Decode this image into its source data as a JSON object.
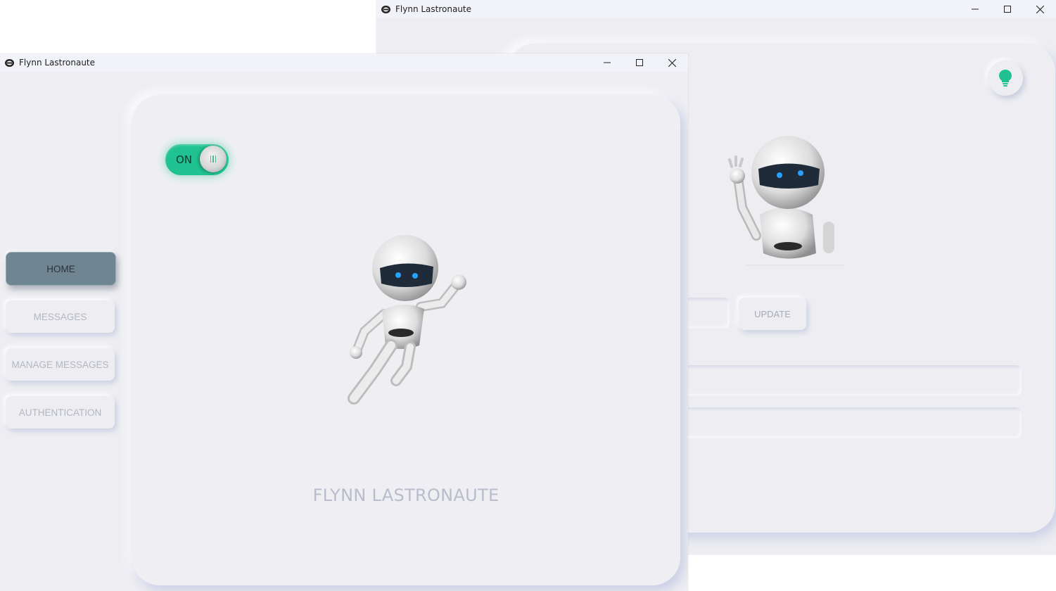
{
  "windows": {
    "back": {
      "title": "Flynn Lastronaute",
      "update_label": "UPDATE",
      "bulb_icon": "lightbulb-icon",
      "accent": "#1fc290"
    },
    "front": {
      "title": "Flynn Lastronaute",
      "nav": {
        "items": [
          {
            "label": "HOME",
            "active": true
          },
          {
            "label": "MESSAGES",
            "active": false
          },
          {
            "label": "MANAGE MESSAGES",
            "active": false
          },
          {
            "label": "AUTHENTICATION",
            "active": false
          }
        ]
      },
      "toggle": {
        "label": "ON",
        "state": true,
        "color": "#1fc290"
      },
      "brand_name": "FLYNN LASTRONAUTE"
    }
  },
  "colors": {
    "background": "#eeeef2",
    "active_nav": "#6f8591",
    "muted_text": "#b3b7c0"
  }
}
